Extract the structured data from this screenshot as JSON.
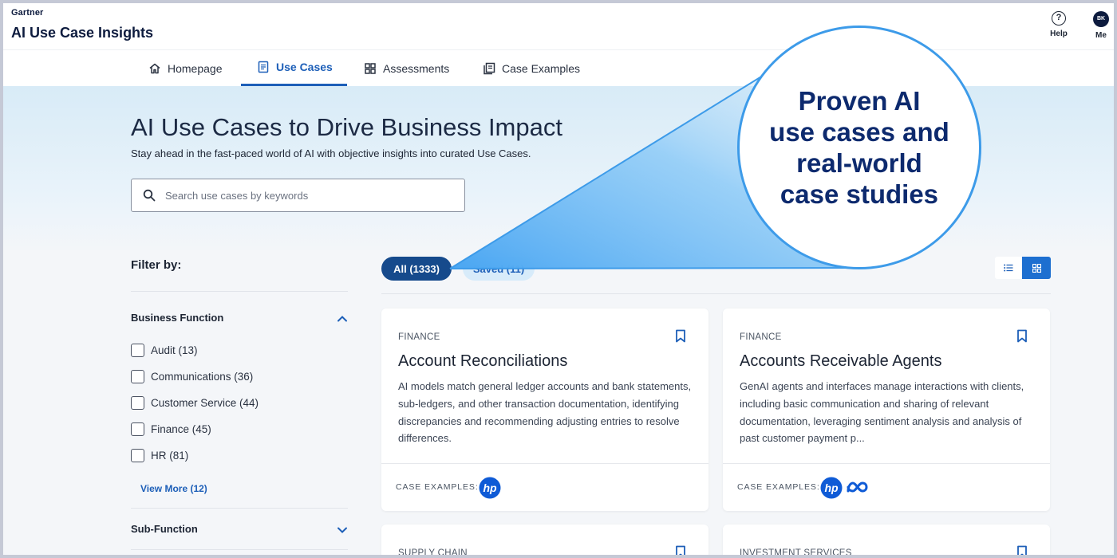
{
  "header": {
    "brand": "Gartner",
    "app_title": "AI Use Case Insights",
    "help_label": "Help",
    "me_label": "Me",
    "avatar_initials": "BK"
  },
  "nav": {
    "items": [
      {
        "label": "Homepage",
        "icon": "home-icon",
        "active": false
      },
      {
        "label": "Use Cases",
        "icon": "document-icon",
        "active": true
      },
      {
        "label": "Assessments",
        "icon": "grid-icon",
        "active": false
      },
      {
        "label": "Case Examples",
        "icon": "copy-icon",
        "active": false
      }
    ]
  },
  "hero": {
    "title": "AI Use Cases to Drive Business Impact",
    "subtitle": "Stay ahead in the fast-paced world of AI with objective insights into curated Use Cases.",
    "search_placeholder": "Search use cases by keywords"
  },
  "callout": {
    "line1": "Proven AI",
    "line2": "use cases and",
    "line3": "real-world",
    "line4": "case studies"
  },
  "filter": {
    "title": "Filter by:",
    "business_function": {
      "label": "Business Function",
      "options": [
        "Audit (13)",
        "Communications (36)",
        "Customer Service (44)",
        "Finance (45)",
        "HR (81)"
      ],
      "view_more": "View More (12)"
    },
    "sub_function": {
      "label": "Sub-Function"
    }
  },
  "tabs": {
    "all": "All (1333)",
    "saved": "Saved (11)"
  },
  "cards": [
    {
      "category": "FINANCE",
      "title": "Account Reconciliations",
      "description": "AI models match general ledger accounts and bank statements, sub-ledgers, and other transaction documentation, identifying discrepancies and recommending adjusting entries to resolve differences.",
      "case_examples_label": "CASE EXAMPLES:",
      "logos": [
        "hp-logo"
      ]
    },
    {
      "category": "FINANCE",
      "title": "Accounts Receivable Agents",
      "description": "GenAI agents and interfaces manage interactions with clients, including basic communication and sharing of relevant documentation, leveraging sentiment analysis and analysis of past customer payment p...",
      "case_examples_label": "CASE EXAMPLES:",
      "logos": [
        "hp-logo",
        "meta-logo"
      ]
    },
    {
      "category": "SUPPLY CHAIN"
    },
    {
      "category": "INVESTMENT SERVICES"
    }
  ],
  "colors": {
    "accent": "#1d5fb8",
    "pill_active": "#164a8c",
    "callout_border": "#3d9be9",
    "callout_text": "#0d2a6e"
  }
}
